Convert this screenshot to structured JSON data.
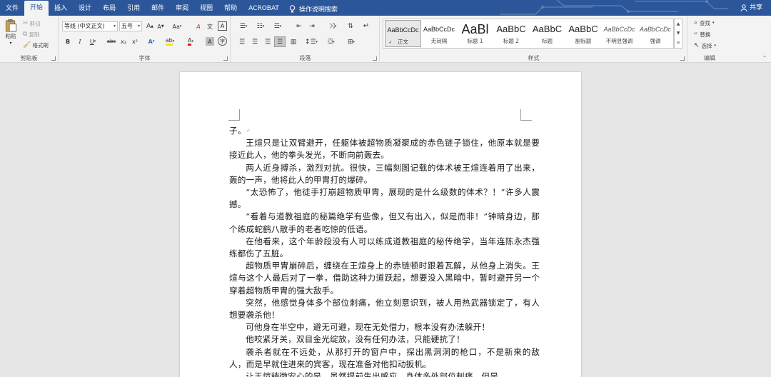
{
  "tabs": [
    "文件",
    "开始",
    "插入",
    "设计",
    "布局",
    "引用",
    "邮件",
    "审阅",
    "视图",
    "帮助",
    "ACROBAT"
  ],
  "active_tab": "开始",
  "tell_me": "操作说明搜索",
  "share": "共享",
  "clipboard": {
    "paste": "粘贴",
    "cut": "剪切",
    "copy": "复制",
    "format_painter": "格式刷",
    "label": "剪贴板"
  },
  "font": {
    "name": "等线 (中文正文)",
    "size": "五号",
    "label": "字体",
    "grow": "A",
    "shrink": "A",
    "case": "Aa",
    "clear": "A",
    "phonetic": "文",
    "border_char": "A",
    "bold": "B",
    "italic": "I",
    "underline": "U",
    "strike": "abc",
    "sub": "x₂",
    "super": "x²",
    "effects": "A",
    "highlight": "ab",
    "color": "A",
    "shade": "A",
    "enclose": "字"
  },
  "paragraph": {
    "label": "段落"
  },
  "styles": {
    "label": "样式",
    "items": [
      {
        "preview": "AaBbCcDc",
        "name": "正文",
        "size": "9px",
        "selected": true
      },
      {
        "preview": "AaBbCcDc",
        "name": "无间隔",
        "size": "9px",
        "selected": false
      },
      {
        "preview": "AaBl",
        "name": "标题 1",
        "size": "18px",
        "selected": false
      },
      {
        "preview": "AaBbC",
        "name": "标题 2",
        "size": "13px",
        "selected": false
      },
      {
        "preview": "AaBbC",
        "name": "标题",
        "size": "13px",
        "selected": false
      },
      {
        "preview": "AaBbC",
        "name": "副标题",
        "size": "13px",
        "selected": false
      },
      {
        "preview": "AaBbCcDc",
        "name": "不明显强调",
        "size": "9px",
        "selected": false
      },
      {
        "preview": "AaBbCcDc",
        "name": "强调",
        "size": "9px",
        "selected": false
      }
    ]
  },
  "editing": {
    "label": "编辑",
    "find": "查找",
    "replace": "替换",
    "select": "选择"
  },
  "document": {
    "paragraphs": [
      {
        "text": "子。",
        "indent": false,
        "ret": true
      },
      {
        "text": "王煊只是让双臂避开，任躯体被超物质凝聚成的赤色链子锁住，他原本就是要接近此人，他的拳头发光，不断向前轰去。",
        "indent": true
      },
      {
        "text": "两人近身搏杀，激烈对抗。很快，三幅刻图记载的体术被王煊连着用了出来，轰的一声，他将此人的甲胄打的爆碎。",
        "indent": true
      },
      {
        "text": "“太恐怖了，他徒手打崩超物质甲胄，展现的是什么级数的体术？！”许多人震撼。",
        "indent": true
      },
      {
        "text": "“看着与道教祖庭的秘篇绝学有些像，但又有出入，似是而非！”钟晴身边，那个练成蛇鹤八散手的老者吃惊的低语。",
        "indent": true
      },
      {
        "text": "在他看来，这个年龄段没有人可以练成道教祖庭的秘传绝学，当年连陈永杰强练都伤了五脏。",
        "indent": true
      },
      {
        "text": "超物质甲胄崩碎后，缠绕在王煊身上的赤链顿时跟着瓦解，从他身上消失。王煊与这个人最后对了一拳，借助这种力道跃起，想要没入黑暗中，暂时避开另一个穿着超物质甲胄的强大敌手。",
        "indent": true
      },
      {
        "text": "突然，他感觉身体多个部位刺痛，他立刻意识到，被人用热武器锁定了，有人想要袭杀他！",
        "indent": true
      },
      {
        "text": "可他身在半空中，避无可避，现在无处借力，根本没有办法躲开！",
        "indent": true
      },
      {
        "text": "他咬紧牙关，双目金光绽放，没有任何办法，只能硬抗了！",
        "indent": true
      },
      {
        "text": "袭杀者就在不远处，从那打开的窗户中，探出黑洞洞的枪口，不是新来的敌人，而是早就住进来的宾客，现在准备对他扣动扳机。",
        "indent": true
      },
      {
        "text": "让王煊稍微安心的是，虽然提前生出感应，身体多处部位刺痛，但是",
        "indent": true
      }
    ]
  }
}
